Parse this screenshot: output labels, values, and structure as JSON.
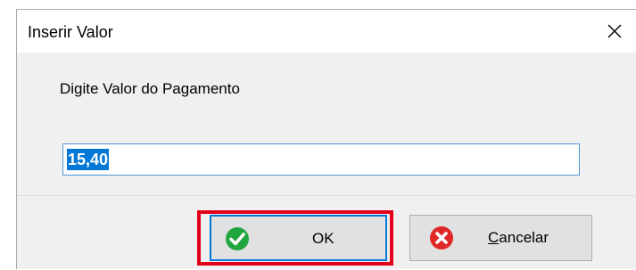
{
  "dialog": {
    "title": "Inserir Valor",
    "prompt": "Digite Valor do Pagamento",
    "input_value": "15,40",
    "buttons": {
      "ok_label": "OK",
      "cancel_label": "Cancelar"
    },
    "icons": {
      "close": "close-icon",
      "ok": "check-circle-icon",
      "cancel": "x-circle-icon"
    },
    "colors": {
      "ok_icon": "#21a53f",
      "cancel_icon": "#e02828",
      "highlight": "#e4001b",
      "selection": "#0078d7"
    }
  }
}
